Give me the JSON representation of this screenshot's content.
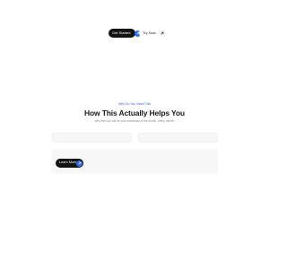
{
  "header": {
    "primary_button_label": "Get Started",
    "secondary_button_label": "Try Now"
  },
  "hero": {
    "eyebrow": "Why Do You Need This",
    "title": "How This Actually Helps You",
    "subtitle": "Why this tool will be your teammate of the month, every month."
  },
  "inputs": {
    "first_placeholder": "",
    "second_placeholder": ""
  },
  "panel": {
    "button_label": "Learn More"
  },
  "icons": {
    "primary_arrow": "arrow-up-right-icon",
    "secondary_arrow": "arrow-up-right-icon",
    "panel_arrow": "arrow-up-right-icon"
  },
  "colors": {
    "accent": "#2f67ee",
    "dark": "#121212",
    "muted_text": "#8a8a8a",
    "surface": "#f7f7f7"
  }
}
